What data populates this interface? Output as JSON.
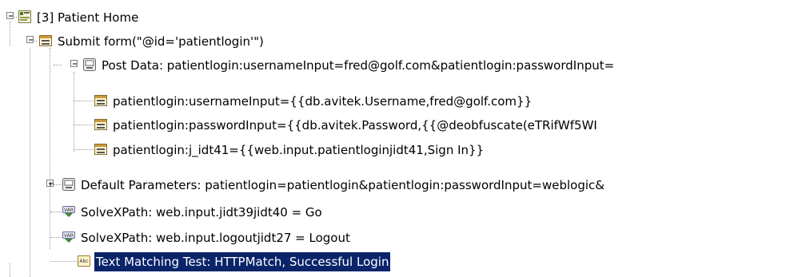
{
  "tree": {
    "nodes": [
      {
        "id": "patient-home",
        "label": "[3] Patient Home",
        "icon": "page-icon",
        "expander": "minus",
        "selected": false
      },
      {
        "id": "submit-form",
        "label": "Submit form(\"@id='patientlogin'\")",
        "icon": "form-icon",
        "expander": "minus",
        "selected": false
      },
      {
        "id": "post-data",
        "label": "Post Data: patientlogin:usernameInput=fred@golf.com&patientlogin:passwordInput=",
        "icon": "parameters-icon",
        "expander": "minus",
        "selected": false
      },
      {
        "id": "username-input",
        "label": "patientlogin:usernameInput={{db.avitek.Username,fred@golf.com}}",
        "icon": "form-field-icon",
        "expander": null,
        "selected": false
      },
      {
        "id": "password-input",
        "label": "patientlogin:passwordInput={{db.avitek.Password,{{@deobfuscate(eTRifWf5WI",
        "icon": "form-field-icon",
        "expander": null,
        "selected": false
      },
      {
        "id": "j-idt41",
        "label": "patientlogin:j_idt41={{web.input.patientloginjidt41,Sign In}}",
        "icon": "form-field-icon",
        "expander": null,
        "selected": false
      },
      {
        "id": "default-parameters",
        "label": "Default Parameters: patientlogin=patientlogin&patientlogin:passwordInput=weblogic&",
        "icon": "parameters-icon",
        "expander": "plus",
        "selected": false
      },
      {
        "id": "solvexpath-go",
        "label": "SolveXPath: web.input.jidt39jidt40 = Go",
        "icon": "var-icon",
        "expander": null,
        "selected": false
      },
      {
        "id": "solvexpath-logout",
        "label": "SolveXPath: web.input.logoutjidt27 = Logout",
        "icon": "var-icon",
        "expander": null,
        "selected": false
      },
      {
        "id": "text-matching",
        "label": "Text Matching Test: HTTPMatch, Successful Login",
        "icon": "abc-icon",
        "expander": null,
        "selected": true
      }
    ]
  },
  "colors": {
    "selection_background": "#0a246a",
    "selection_text": "#ffffff",
    "tree_lines": "#9a9a9a"
  }
}
